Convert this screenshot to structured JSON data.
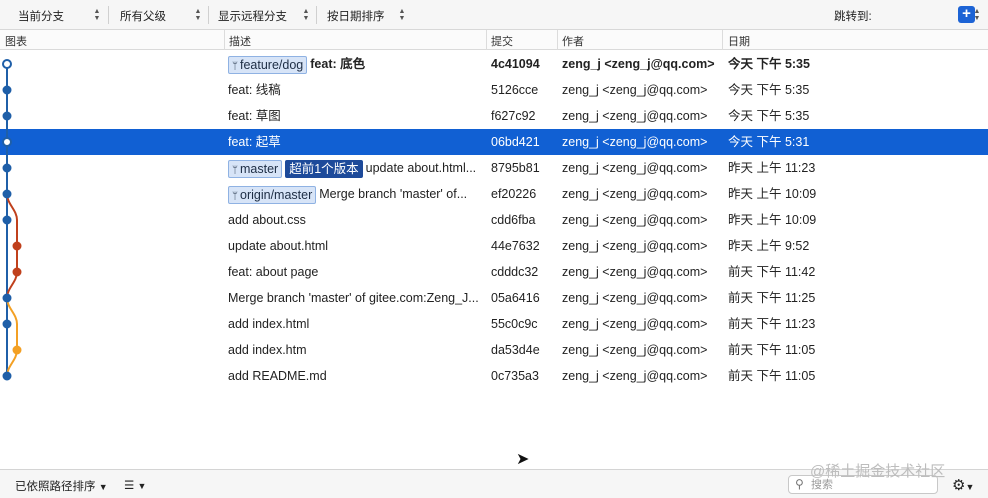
{
  "toolbar": {
    "branch_filter": "当前分支",
    "parent_filter": "所有父级",
    "remote_filter": "显示远程分支",
    "sort_filter": "按日期排序",
    "jump_to": "跳转到:"
  },
  "columns": {
    "graph": "图表",
    "description": "描述",
    "commit": "提交",
    "author": "作者",
    "date": "日期"
  },
  "commits": [
    {
      "tags": [
        {
          "label": "feature/dog",
          "icon": "branch-icon"
        }
      ],
      "message": "feat: 底色",
      "hash": "4c41094",
      "author": "zeng_j <zeng_j@qq.com>",
      "date": "今天 下午 5:35"
    },
    {
      "tags": [],
      "message": "feat: 线稿",
      "hash": "5126cce",
      "author": "zeng_j <zeng_j@qq.com>",
      "date": "今天 下午 5:35"
    },
    {
      "tags": [],
      "message": "feat: 草图",
      "hash": "f627c92",
      "author": "zeng_j <zeng_j@qq.com>",
      "date": "今天 下午 5:35"
    },
    {
      "tags": [],
      "message": "feat: 起草",
      "hash": "06bd421",
      "author": "zeng_j <zeng_j@qq.com>",
      "date": "今天 下午 5:31"
    },
    {
      "tags": [
        {
          "label": "master",
          "icon": "branch-icon"
        },
        {
          "label": "超前1个版本",
          "icon": ""
        }
      ],
      "message": "update about.html...",
      "hash": "8795b81",
      "author": "zeng_j <zeng_j@qq.com>",
      "date": "昨天 上午 11:23"
    },
    {
      "tags": [
        {
          "label": "origin/master",
          "icon": "branch-icon"
        }
      ],
      "message": "Merge branch 'master' of...",
      "hash": "ef20226",
      "author": "zeng_j <zeng_j@qq.com>",
      "date": "昨天 上午 10:09"
    },
    {
      "tags": [],
      "message": "add about.css",
      "hash": "cdd6fba",
      "author": "zeng_j <zeng_j@qq.com>",
      "date": "昨天 上午 10:09"
    },
    {
      "tags": [],
      "message": "update about.html",
      "hash": "44e7632",
      "author": "zeng_j <zeng_j@qq.com>",
      "date": "昨天 上午 9:52"
    },
    {
      "tags": [],
      "message": "feat: about page",
      "hash": "cdddc32",
      "author": "zeng_j <zeng_j@qq.com>",
      "date": "前天 下午 11:42"
    },
    {
      "tags": [],
      "message": "Merge branch 'master' of gitee.com:Zeng_J...",
      "hash": "05a6416",
      "author": "zeng_j <zeng_j@qq.com>",
      "date": "前天 下午 11:25"
    },
    {
      "tags": [],
      "message": "add index.html",
      "hash": "55c0c9c",
      "author": "zeng_j <zeng_j@qq.com>",
      "date": "前天 下午 11:23"
    },
    {
      "tags": [],
      "message": "add index.htm",
      "hash": "da53d4e",
      "author": "zeng_j <zeng_j@qq.com>",
      "date": "前天 下午 11:05"
    },
    {
      "tags": [],
      "message": "add README.md",
      "hash": "0c735a3",
      "author": "zeng_j <zeng_j@qq.com>",
      "date": "前天 下午 11:05"
    }
  ],
  "bold_row": 0,
  "selected_row": 3,
  "bottombar": {
    "sort_mode": "已依照路径排序",
    "search_placeholder": "搜索"
  },
  "watermark": "@稀土掘金技术社区",
  "colors": {
    "selection": "#1160d3",
    "lane_main": "#1f5fa8",
    "lane_red": "#c0401c",
    "lane_orange": "#f3a024"
  },
  "icons": [
    "updown-icon",
    "branch-icon",
    "plus-icon",
    "list-icon",
    "chevron-down-icon",
    "search-icon",
    "gear-icon",
    "cursor-icon"
  ]
}
